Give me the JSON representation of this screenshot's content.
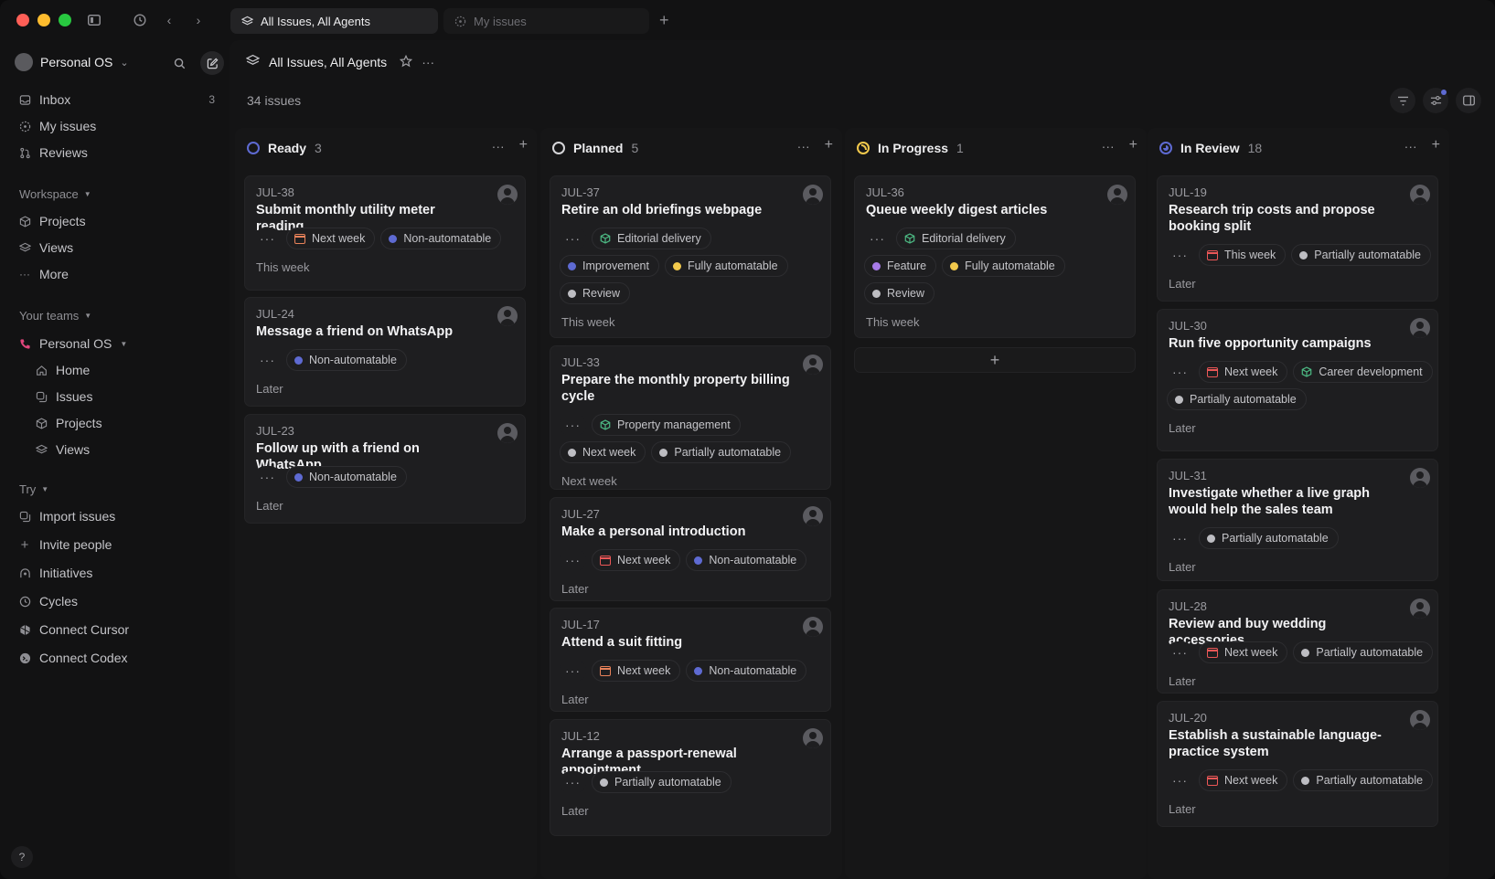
{
  "titlebar": {
    "tabs": [
      {
        "label": "All Issues, All Agents",
        "active": true
      },
      {
        "label": "My issues",
        "active": false
      }
    ]
  },
  "sidebar": {
    "workspace_name": "Personal OS",
    "nav": [
      {
        "label": "Inbox",
        "count": "3",
        "icon": "inbox-icon"
      },
      {
        "label": "My issues",
        "icon": "my-issues-icon"
      },
      {
        "label": "Reviews",
        "icon": "reviews-icon"
      }
    ],
    "workspace_section": "Workspace",
    "workspace_items": [
      {
        "label": "Projects",
        "icon": "cube-icon"
      },
      {
        "label": "Views",
        "icon": "layers-icon"
      },
      {
        "label": "More",
        "icon": "more-icon"
      }
    ],
    "teams_section": "Your teams",
    "team_name": "Personal OS",
    "team_items": [
      {
        "label": "Home",
        "icon": "home-icon"
      },
      {
        "label": "Issues",
        "icon": "issues-icon"
      },
      {
        "label": "Projects",
        "icon": "cube-icon"
      },
      {
        "label": "Views",
        "icon": "layers-icon"
      }
    ],
    "try_section": "Try",
    "try_items": [
      {
        "label": "Import issues",
        "icon": "import-icon"
      },
      {
        "label": "Invite people",
        "icon": "plus-icon"
      },
      {
        "label": "Initiatives",
        "icon": "initiatives-icon"
      },
      {
        "label": "Cycles",
        "icon": "cycles-icon"
      },
      {
        "label": "Connect Cursor",
        "icon": "cursor-icon"
      },
      {
        "label": "Connect Codex",
        "icon": "codex-icon"
      }
    ],
    "help": "?"
  },
  "main": {
    "title": "All Issues, All Agents",
    "issue_count": "34 issues"
  },
  "colors": {
    "ready": "#5e6ad2",
    "planned": "#d6d6d9",
    "in_progress": "#f2c94c",
    "in_review": "#5e6ad2",
    "label_blue": "#5e6ad2",
    "label_yellow": "#f2c94c",
    "label_purple": "#a77be8",
    "label_gray": "#bdbdc2",
    "calendar_orange": "#e8825a",
    "calendar_red": "#eb5757",
    "project_green": "#4cb782"
  },
  "columns": [
    {
      "title": "Ready",
      "count": "3",
      "cards": [
        {
          "id": "JUL-38",
          "title": "Submit monthly utility meter reading",
          "chips": [
            [
              "Next week",
              "cal-orange"
            ],
            [
              "Non-automatable",
              "blue"
            ]
          ],
          "footer": "This week"
        },
        {
          "id": "JUL-24",
          "title": "Message a friend on WhatsApp",
          "chips": [
            [
              "Non-automatable",
              "blue"
            ]
          ],
          "footer": "Later"
        },
        {
          "id": "JUL-23",
          "title": "Follow up with a friend on WhatsApp",
          "chips": [
            [
              "Non-automatable",
              "blue"
            ]
          ],
          "footer": "Later"
        }
      ]
    },
    {
      "title": "Planned",
      "count": "5",
      "cards": [
        {
          "id": "JUL-37",
          "title": "Retire an old briefings webpage",
          "chips": [
            [
              "Editorial delivery",
              "cube"
            ]
          ],
          "chips2": [
            [
              "Improvement",
              "blue"
            ],
            [
              "Fully automatable",
              "yellow"
            ]
          ],
          "chips3": [
            [
              "Review",
              "gray"
            ]
          ],
          "footer": "This week"
        },
        {
          "id": "JUL-33",
          "title": "Prepare the monthly property billing cycle",
          "chips": [
            [
              "Property management",
              "cube"
            ]
          ],
          "chips2": [
            [
              "Next week",
              "gray"
            ],
            [
              "Partially automatable",
              "gray"
            ]
          ],
          "footer": "Next week"
        },
        {
          "id": "JUL-27",
          "title": "Make a personal introduction",
          "chips": [
            [
              "Next week",
              "cal-red"
            ],
            [
              "Non-automatable",
              "blue"
            ]
          ],
          "footer": "Later"
        },
        {
          "id": "JUL-17",
          "title": "Attend a suit fitting",
          "chips": [
            [
              "Next week",
              "cal-orange"
            ],
            [
              "Non-automatable",
              "blue"
            ]
          ],
          "footer": "Later"
        },
        {
          "id": "JUL-12",
          "title": "Arrange a passport-renewal appointment",
          "chips": [
            [
              "Partially automatable",
              "gray"
            ]
          ],
          "footer": "Later"
        }
      ]
    },
    {
      "title": "In Progress",
      "count": "1",
      "cards": [
        {
          "id": "JUL-36",
          "title": "Queue weekly digest articles",
          "chips": [
            [
              "Editorial delivery",
              "cube"
            ]
          ],
          "chips2": [
            [
              "Feature",
              "purple"
            ],
            [
              "Fully automatable",
              "yellow"
            ]
          ],
          "chips3": [
            [
              "Review",
              "gray"
            ]
          ],
          "footer": "This week"
        }
      ]
    },
    {
      "title": "In Review",
      "count": "18",
      "cards": [
        {
          "id": "JUL-19",
          "title": "Research trip costs and propose booking split",
          "chips": [
            [
              "This week",
              "cal-red"
            ],
            [
              "Partially automatable",
              "gray"
            ]
          ],
          "footer": "Later"
        },
        {
          "id": "JUL-30",
          "title": "Run five opportunity campaigns",
          "chips": [
            [
              "Next week",
              "cal-red"
            ],
            [
              "Career development",
              "cube"
            ]
          ],
          "chips2": [
            [
              "Partially automatable",
              "gray"
            ]
          ],
          "footer": "Later"
        },
        {
          "id": "JUL-31",
          "title": "Investigate whether a live graph would help the sales team",
          "chips": [
            [
              "Partially automatable",
              "gray"
            ]
          ],
          "footer": "Later"
        },
        {
          "id": "JUL-28",
          "title": "Review and buy wedding accessories",
          "chips": [
            [
              "Next week",
              "cal-red"
            ],
            [
              "Partially automatable",
              "gray"
            ]
          ],
          "footer": "Later"
        },
        {
          "id": "JUL-20",
          "title": "Establish a sustainable language-practice system",
          "chips": [
            [
              "Next week",
              "cal-red"
            ],
            [
              "Partially automatable",
              "gray"
            ]
          ],
          "footer": "Later"
        }
      ]
    }
  ]
}
